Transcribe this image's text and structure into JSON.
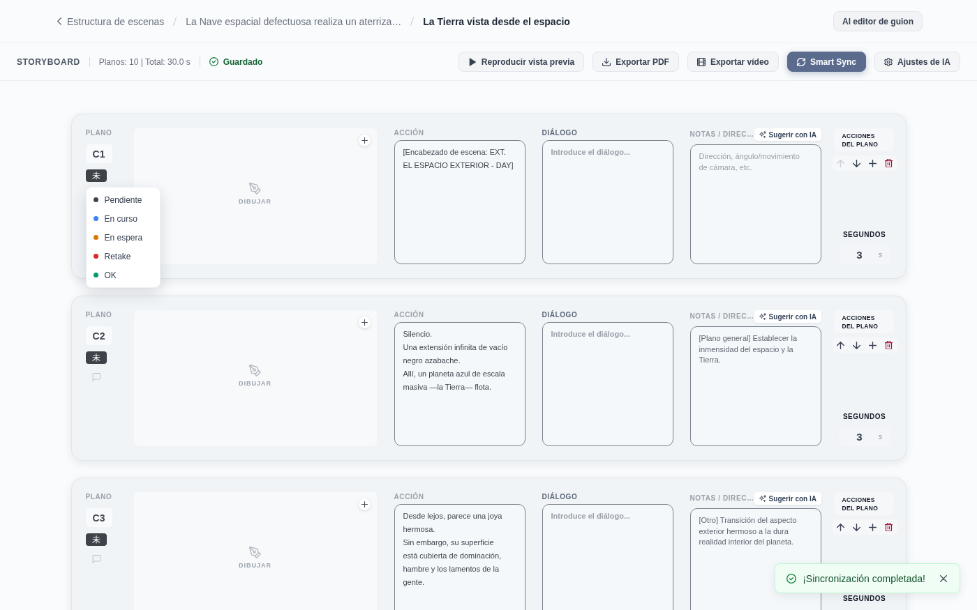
{
  "breadcrumb": [
    {
      "label": "Estructura de escenas",
      "current": false
    },
    {
      "label": "La Nave espacial defectuosa realiza un aterriza…",
      "current": false
    },
    {
      "label": "La Tierra vista desde el espacio",
      "current": true
    }
  ],
  "editor_button": "Al editor de guion",
  "toolbar": {
    "title": "STORYBOARD",
    "summary": "Planos: 10 | Total: 30.0 s",
    "save_status": "Guardado",
    "buttons": [
      {
        "label": "Reproducir vista previa",
        "primary": false
      },
      {
        "label": "Exportar PDF",
        "primary": false
      },
      {
        "label": "Exportar vídeo",
        "primary": false
      },
      {
        "label": "Smart Sync",
        "primary": true
      },
      {
        "label": "Ajustes de IA",
        "primary": false
      }
    ]
  },
  "cards": [
    {
      "plano_label": "PLANO",
      "shot": "C1",
      "status": "未",
      "status_menu": {
        "items": [
          {
            "label": "Pendiente",
            "color": "#3f4349",
            "selected": false
          },
          {
            "label": "En curso",
            "color": "#3b82f6",
            "selected": false
          },
          {
            "label": "En espera",
            "color": "#d97706",
            "selected": false
          },
          {
            "label": "Retake",
            "color": "#dc2626",
            "selected": false
          },
          {
            "label": "OK",
            "color": "#059669",
            "selected": false
          }
        ]
      },
      "draw_label": "DIBUJAR",
      "action_label": "ACCIÓN",
      "action": {
        "value": "[Encabezado de escena: EXT.\nEL ESPACIO EXTERIOR - DAY]"
      },
      "dialogue_label": "DIÁLOGO",
      "dialogue": {
        "placeholder": "Introduce el diálogo..."
      },
      "notes_label": "NOTAS / DIREC…",
      "suggest_button": "Sugerir con IA",
      "notes": {
        "placeholder": "Dirección, ángulo/movimiento\nde cámara, etc."
      },
      "actions_label": "ACCIONES DEL PLANO",
      "move_up_disabled": true,
      "seconds_label": "SEGUNDOS",
      "seconds": "3",
      "seconds_unit": "s"
    },
    {
      "plano_label": "PLANO",
      "shot": "C2",
      "status": "未",
      "draw_label": "DIBUJAR",
      "action_label": "ACCIÓN",
      "action": {
        "value": "Silencio.\nUna extensión infinita de vacío\nnegro azabache.\nAllí, un planeta azul de escala\nmasiva —la Tierra— flota."
      },
      "dialogue_label": "DIÁLOGO",
      "dialogue": {
        "placeholder": "Introduce el diálogo..."
      },
      "notes_label": "NOTAS / DIREC…",
      "suggest_button": "Sugerir con IA",
      "notes": {
        "value": "[Plano general] Establecer la\ninmensidad del espacio y la\nTierra."
      },
      "actions_label": "ACCIONES DEL PLANO",
      "move_up_disabled": false,
      "seconds_label": "SEGUNDOS",
      "seconds": "3",
      "seconds_unit": "s"
    },
    {
      "plano_label": "PLANO",
      "shot": "C3",
      "status": "未",
      "draw_label": "DIBUJAR",
      "action_label": "ACCIÓN",
      "action": {
        "value": "Desde lejos, parece una joya\nhermosa.\nSin embargo, su superficie\nestá cubierta de dominación,\nhambre y los lamentos de la\ngente."
      },
      "dialogue_label": "DIÁLOGO",
      "dialogue": {
        "placeholder": "Introduce el diálogo..."
      },
      "notes_label": "NOTAS / DIREC…",
      "suggest_button": "Sugerir con IA",
      "notes": {
        "value": "[Otro] Transición del aspecto\nexterior hermoso a la dura\nrealidad interior del planeta."
      },
      "actions_label": "ACCIONES DEL PLANO",
      "move_up_disabled": false,
      "seconds_label": "SEGUNDOS"
    }
  ],
  "toast": {
    "message": "¡Sincronización completada!"
  }
}
